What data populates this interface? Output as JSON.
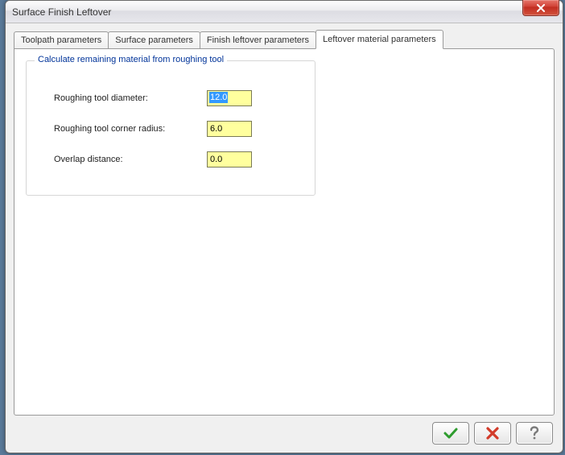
{
  "window": {
    "title": "Surface Finish Leftover"
  },
  "tabs": [
    {
      "label": "Toolpath parameters"
    },
    {
      "label": "Surface parameters"
    },
    {
      "label": "Finish leftover parameters"
    },
    {
      "label": "Leftover material parameters"
    }
  ],
  "group": {
    "legend": "Calculate remaining material from roughing tool"
  },
  "fields": {
    "diameter": {
      "label": "Roughing tool diameter:",
      "value": "12.0"
    },
    "corner": {
      "label": "Roughing tool corner radius:",
      "value": "6.0"
    },
    "overlap": {
      "label": "Overlap distance:",
      "value": "0.0"
    }
  },
  "buttons": {
    "ok": "ok-button",
    "cancel": "cancel-button",
    "help": "help-button"
  }
}
